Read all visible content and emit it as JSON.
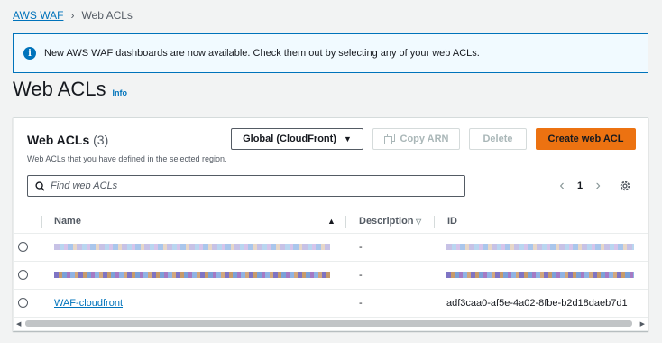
{
  "breadcrumb": {
    "root": "AWS WAF",
    "current": "Web ACLs"
  },
  "flash": {
    "message": "New AWS WAF dashboards are now available. Check them out by selecting any of your web ACLs.",
    "icon": "info-icon"
  },
  "page": {
    "title": "Web ACLs",
    "info_link": "Info"
  },
  "table_container": {
    "title": "Web ACLs",
    "count": "(3)",
    "description": "Web ACLs that you have defined in the selected region.",
    "region_select": "Global (CloudFront)",
    "copy_arn_label": "Copy ARN",
    "delete_label": "Delete",
    "create_label": "Create web ACL",
    "search_placeholder": "Find web ACLs",
    "page_number": "1"
  },
  "table": {
    "columns": {
      "name": "Name",
      "description": "Description",
      "id": "ID"
    },
    "rows": [
      {
        "name": "",
        "description": "-",
        "id": "",
        "redacted": true
      },
      {
        "name": "",
        "description": "-",
        "id": "",
        "redacted": true
      },
      {
        "name": "WAF-cloudfront",
        "description": "-",
        "id": "adf3caa0-af5e-4a02-8fbe-b2d18daeb7d1",
        "redacted": false
      }
    ]
  },
  "colors": {
    "link": "#0073bb",
    "primary_button": "#ec7211",
    "flash_bg": "#f1faff",
    "page_bg": "#f2f3f3"
  }
}
